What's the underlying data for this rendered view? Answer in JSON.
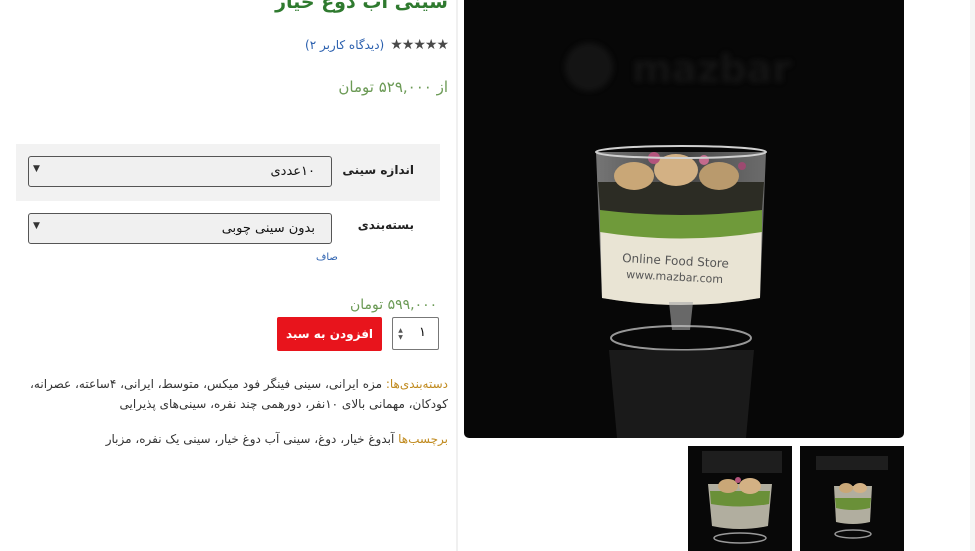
{
  "product": {
    "title": "سینی آب دوغ خیار",
    "stars": "★★★★★",
    "reviews": "(دیدگاه کاربر ۲)",
    "price_from": "از ۵۲۹,۰۰۰ تومان"
  },
  "variations": {
    "size_label": "اندازه سینی",
    "size_value": "۱۰عددی",
    "package_label": "بسته‌بندی",
    "package_value": "بدون سینی چوبی",
    "clear_label": "صاف"
  },
  "purchase": {
    "variation_price": "۵۹۹,۰۰۰ تومان",
    "quantity": "۱",
    "add_to_cart": "افزودن به سبد"
  },
  "meta": {
    "categories_label": "دسته‌بندی‌ها:",
    "categories": " مزه ایرانی، سینی فینگر فود میکس، متوسط، ایرانی، ۴ساعته، عصرانه، کودکان، مهمانی بالای ۱۰نفر، دورهمی چند نفره، سینی‌های پذیرایی",
    "tags_label": "برچسب‌ها",
    "tags": " آبدوغ خیار، دوغ، سینی آب دوغ خیار، سینی یک نفره، مزبار"
  },
  "image": {
    "watermark": "mazbar",
    "cup_text_1": "Online Food Store",
    "cup_text_2": "www.mazbar.com"
  },
  "icons": {
    "spin": "spinner-icon",
    "chevron": "chevron-down-icon"
  },
  "colors": {
    "title": "#2f7a2f",
    "price": "#6b9a55",
    "button": "#e8141c",
    "link": "#2a5fae",
    "meta_label": "#c08a1e"
  }
}
